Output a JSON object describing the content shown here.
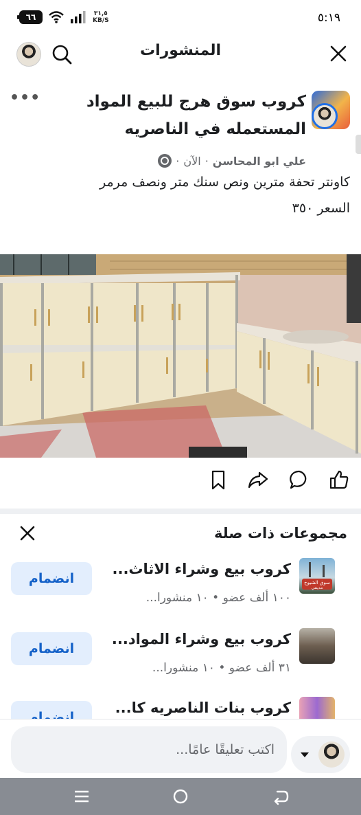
{
  "status": {
    "time": "٥:١٩",
    "battery": "٦٦",
    "netspeed_value": "٣١,٥",
    "netspeed_unit": "KB/S"
  },
  "header": {
    "title": "المنشورات",
    "icons": [
      "close-icon",
      "search-icon"
    ]
  },
  "post": {
    "group_name": "كروب سوق هرج للبيع المواد المستعمله في الناصريه",
    "author": "علي ابو المحاسن",
    "time": "الآن",
    "separator": "·",
    "text_line1": "كاونتر تحفة مترين ونص سنك متر ونصف مرمر",
    "text_line2": "السعر ٣٥٠",
    "actions": [
      "like-icon",
      "comment-icon",
      "share-icon",
      "save-icon"
    ]
  },
  "related": {
    "title": "مجموعات ذات صلة",
    "groups": [
      {
        "name": "كروب بيع وشراء الاثاث...",
        "meta": "١٠٠ ألف عضو • ١٠ منشورا...",
        "join": "انضمام"
      },
      {
        "name": "كروب بيع وشراء المواد...",
        "meta": "٣١ ألف عضو • ١٠ منشورا...",
        "join": "انضمام"
      },
      {
        "name": "كروب بنات الناصريه كا...",
        "meta": "",
        "join": "انضمام"
      }
    ],
    "thumb_label_line1": "سوق الشيوخ",
    "thumb_label_line2": "مدينتي"
  },
  "comment": {
    "placeholder": "اكتب تعليقًا عامًا..."
  },
  "colors": {
    "accent": "#1461c8",
    "join_bg": "#e3eefd",
    "nav_bg": "#888c93"
  }
}
